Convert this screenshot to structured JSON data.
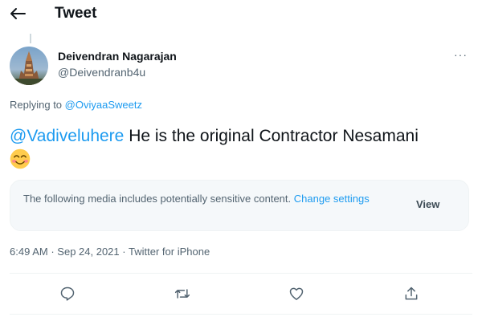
{
  "header": {
    "title": "Tweet",
    "back_icon": "arrow-left-icon"
  },
  "tweet": {
    "author": {
      "name": "Deivendran Nagarajan",
      "handle": "@Deivendranb4u",
      "avatar_icon": "temple-avatar"
    },
    "more_icon": "ellipsis-icon",
    "more_label": "···",
    "replying_prefix": "Replying to",
    "replying_to": "@OviyaaSweetz",
    "mention": "@Vadiveluhere",
    "text": " He is the original Contractor Nesamani",
    "emoji": "smiling-face-with-smiling-eyes",
    "sensitive": {
      "message": "The following media includes potentially sensitive content.",
      "change_label": "Change settings",
      "view_label": "View"
    },
    "time": "6:49 AM",
    "separator": "·",
    "date": "Sep 24, 2021",
    "source": "Twitter for iPhone"
  },
  "actions": [
    {
      "name": "reply",
      "icon": "reply-icon"
    },
    {
      "name": "retweet",
      "icon": "retweet-icon"
    },
    {
      "name": "like",
      "icon": "heart-icon"
    },
    {
      "name": "share",
      "icon": "share-icon"
    }
  ],
  "colors": {
    "accent": "#1d9bf0",
    "text_primary": "#0f1419",
    "text_secondary": "#536471",
    "sensitive_bg": "#f5f8fa"
  }
}
